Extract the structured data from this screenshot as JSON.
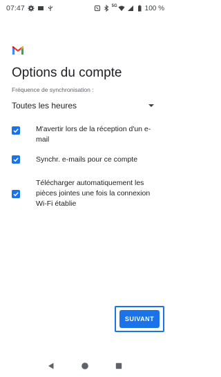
{
  "status_bar": {
    "time": "07:47",
    "network": "5G",
    "battery": "100 %",
    "icons": [
      "settings-icon",
      "sd-card-icon",
      "usb-icon",
      "nfc-icon",
      "bluetooth-icon",
      "wifi-icon",
      "signal-icon",
      "battery-icon"
    ]
  },
  "app": {
    "logo": "gmail-logo"
  },
  "page": {
    "title": "Options du compte",
    "sync_label": "Fréquence de synchronisation :",
    "sync_value": "Toutes les heures"
  },
  "options": [
    {
      "label": "M'avertir lors de la réception d'un e-mail",
      "checked": true
    },
    {
      "label": "Synchr. e-mails pour ce compte",
      "checked": true
    },
    {
      "label": "Télécharger automatiquement les pièces jointes une fois la connexion Wi-Fi établie",
      "checked": true
    }
  ],
  "actions": {
    "next_label": "SUIVANT"
  },
  "colors": {
    "accent": "#1a73e8",
    "text": "#202124",
    "secondary_text": "#5f6368"
  },
  "nav_bar": {
    "icons": [
      "back-icon",
      "home-icon",
      "recents-icon"
    ]
  }
}
